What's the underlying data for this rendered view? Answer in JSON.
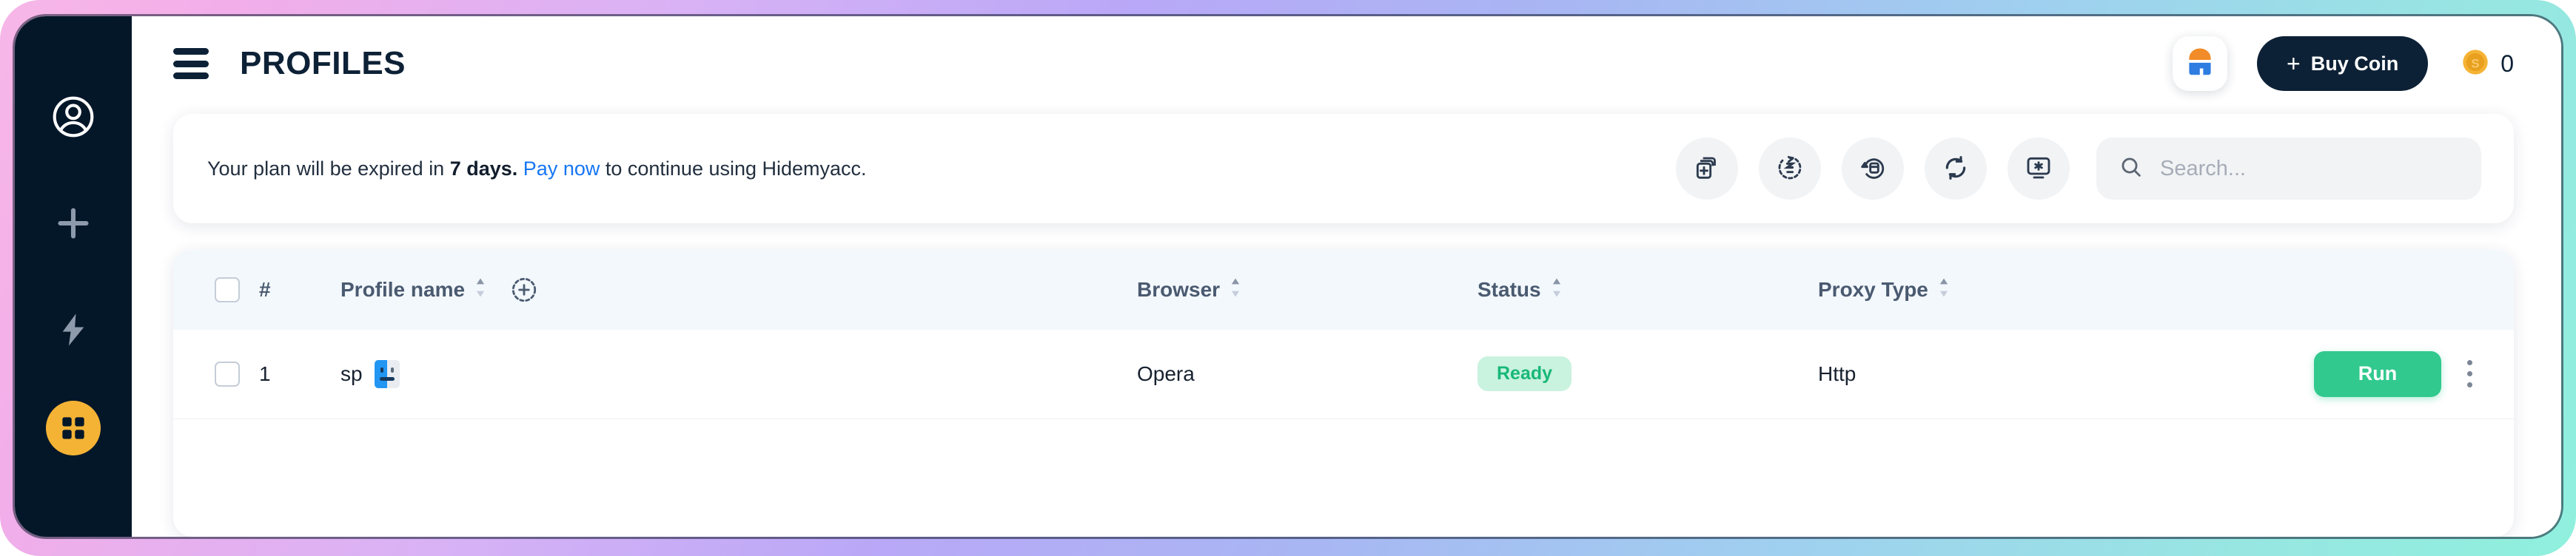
{
  "app": {
    "title": "PROFILES",
    "menu_icon": "hamburger-icon"
  },
  "header": {
    "avatar_icon": "avatar-icon",
    "buy_coin_label": "Buy Coin",
    "buy_coin_plus": "+",
    "coin_icon": "coin-icon",
    "coin_count": "0"
  },
  "notice": {
    "text_before": "Your plan will be expired in ",
    "bold": "7 days.",
    "link": "Pay now",
    "text_after": " to continue using Hidemyacc."
  },
  "toolbar": {
    "buttons": [
      {
        "name": "add-profile-icon",
        "title": "New profile"
      },
      {
        "name": "sync-cookie-icon",
        "title": "Sync cookie"
      },
      {
        "name": "restore-profile-icon",
        "title": "Restore profile"
      },
      {
        "name": "refresh-icon",
        "title": "Refresh"
      },
      {
        "name": "settings-display-icon",
        "title": "Display settings"
      }
    ]
  },
  "search": {
    "icon": "search-icon",
    "placeholder": "Search...",
    "value": ""
  },
  "table": {
    "columns": [
      {
        "key": "check",
        "label": "",
        "sortable": false
      },
      {
        "key": "num",
        "label": "#",
        "sortable": false
      },
      {
        "key": "name",
        "label": "Profile name",
        "sortable": true
      },
      {
        "key": "browser",
        "label": "Browser",
        "sortable": true
      },
      {
        "key": "status",
        "label": "Status",
        "sortable": true
      },
      {
        "key": "proxy",
        "label": "Proxy Type",
        "sortable": true
      },
      {
        "key": "action",
        "label": "",
        "sortable": false
      }
    ],
    "add_column_icon": "add-column-icon",
    "rows": [
      {
        "num": "1",
        "name": "sp",
        "name_emoji": "finder-face-emoji",
        "browser": "Opera",
        "status": "Ready",
        "proxy": "Http",
        "action_label": "Run"
      }
    ]
  },
  "sidebar": {
    "items": [
      {
        "name": "account-icon",
        "active": false
      },
      {
        "name": "add-icon",
        "active": false
      },
      {
        "name": "automation-icon",
        "active": false
      },
      {
        "name": "profiles-grid-icon",
        "active": true
      }
    ]
  },
  "colors": {
    "sidebar_bg": "#041729",
    "accent_dark": "#0d2136",
    "link_blue": "#1676f3",
    "status_green_bg": "#c9f2df",
    "status_green_text": "#18b877",
    "run_green": "#32c98e",
    "coin_yellow": "#F5B335"
  }
}
